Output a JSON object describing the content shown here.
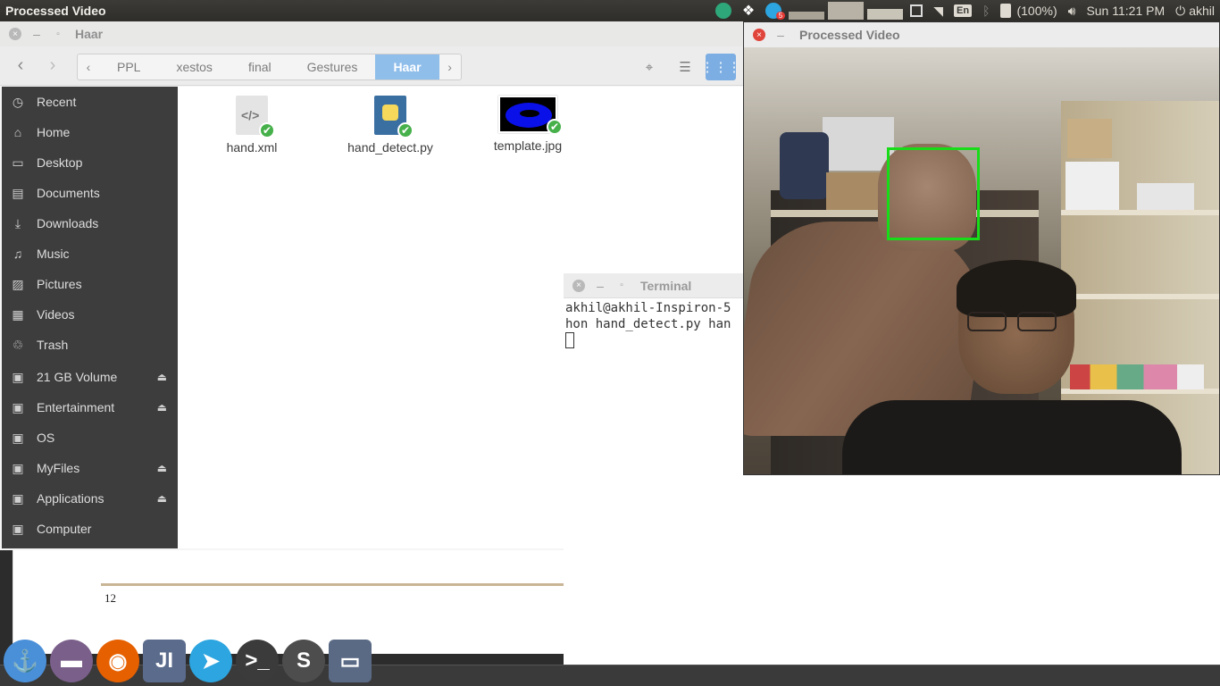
{
  "top_panel": {
    "active_app": "Processed Video",
    "language": "En",
    "battery": "(100%)",
    "clock": "Sun 11:21 PM",
    "user": "akhil",
    "telegram_badge": "5"
  },
  "files": {
    "window_title": "Haar",
    "breadcrumbs": [
      "PPL",
      "xestos",
      "final",
      "Gestures",
      "Haar"
    ],
    "sidebar": [
      {
        "label": "Recent",
        "icon": "clock-icon",
        "eject": false
      },
      {
        "label": "Home",
        "icon": "home-icon",
        "eject": false
      },
      {
        "label": "Desktop",
        "icon": "desktop-icon",
        "eject": false
      },
      {
        "label": "Documents",
        "icon": "document-icon",
        "eject": false
      },
      {
        "label": "Downloads",
        "icon": "download-icon",
        "eject": false
      },
      {
        "label": "Music",
        "icon": "music-icon",
        "eject": false
      },
      {
        "label": "Pictures",
        "icon": "picture-icon",
        "eject": false
      },
      {
        "label": "Videos",
        "icon": "video-icon",
        "eject": false
      },
      {
        "label": "Trash",
        "icon": "trash-icon",
        "eject": false
      },
      {
        "label": "21 GB Volume",
        "icon": "drive-icon",
        "eject": true
      },
      {
        "label": "Entertainment",
        "icon": "drive-icon",
        "eject": true
      },
      {
        "label": "OS",
        "icon": "drive-icon",
        "eject": false
      },
      {
        "label": "MyFiles",
        "icon": "drive-icon",
        "eject": true
      },
      {
        "label": "Applications",
        "icon": "drive-icon",
        "eject": true
      },
      {
        "label": "Computer",
        "icon": "computer-icon",
        "eject": false
      }
    ],
    "items": [
      {
        "name": "hand.xml",
        "icon": "xml-file-icon"
      },
      {
        "name": "hand_detect.py",
        "icon": "python-file-icon"
      },
      {
        "name": "template.jpg",
        "icon": "image-thumbnail-icon"
      }
    ]
  },
  "document": {
    "page_number": "12"
  },
  "terminal": {
    "window_title": "Terminal",
    "lines": [
      "akhil@akhil-Inspiron-5",
      "hon hand_detect.py han"
    ]
  },
  "video": {
    "window_title": "Processed Video"
  },
  "dock": [
    {
      "name": "anchor-icon",
      "color": "#4a90d9"
    },
    {
      "name": "files-icon",
      "color": "#7a5f8a"
    },
    {
      "name": "firefox-icon",
      "color": "#e66000"
    },
    {
      "name": "intellij-icon",
      "color": "#5a6b8c"
    },
    {
      "name": "telegram-icon",
      "color": "#2ca5e0"
    },
    {
      "name": "terminal-icon",
      "color": "#3b3b3b"
    },
    {
      "name": "sublime-icon",
      "color": "#4d4d4d"
    },
    {
      "name": "window-icon",
      "color": "#5a6a85"
    }
  ]
}
